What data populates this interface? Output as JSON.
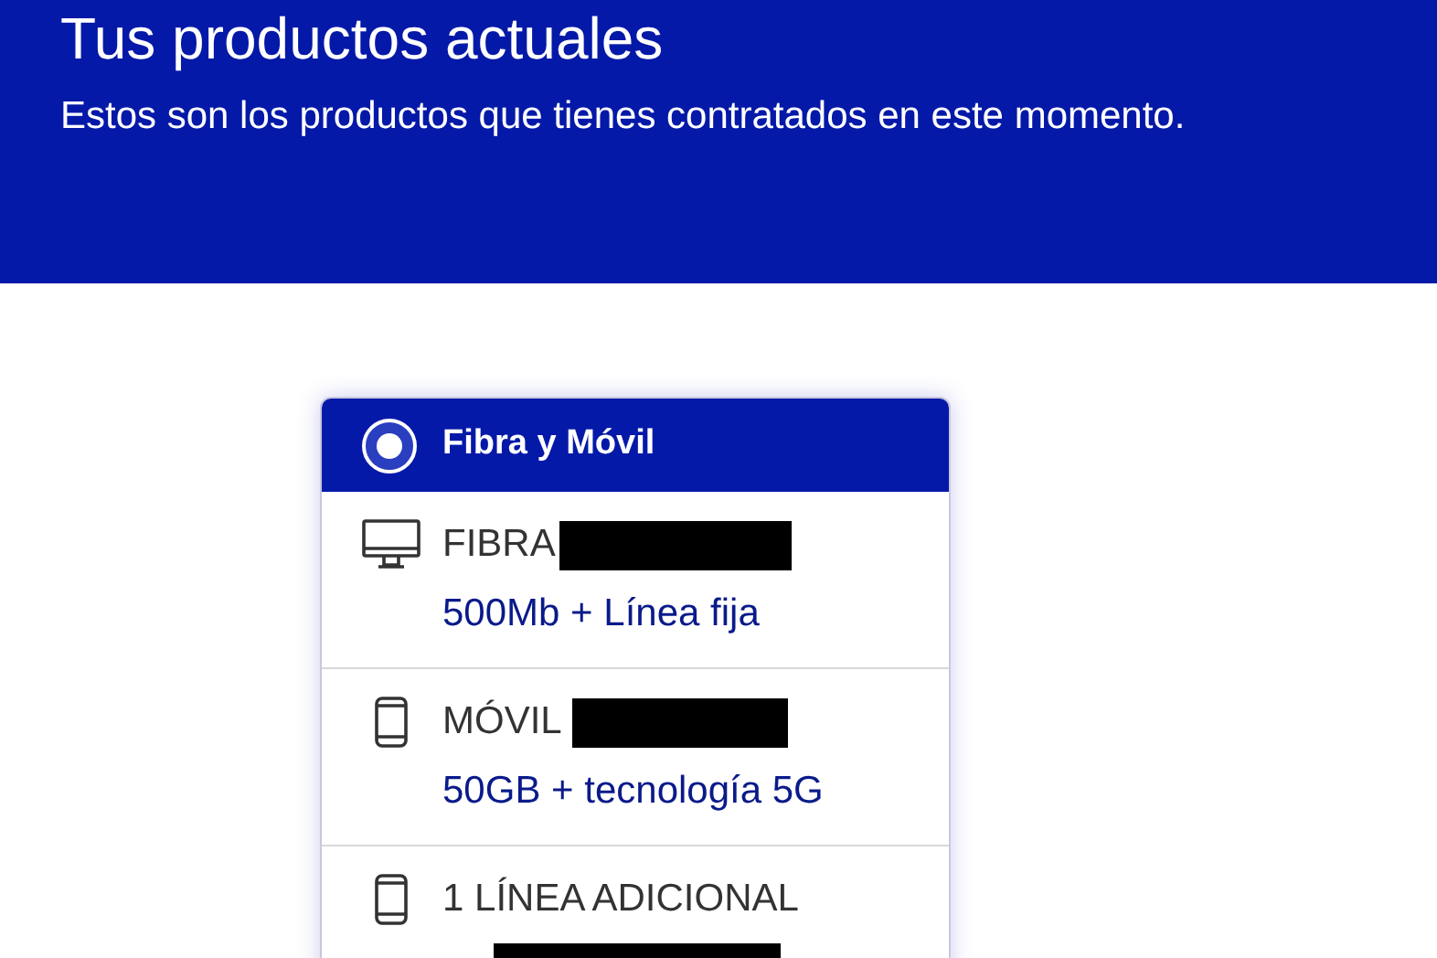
{
  "header": {
    "title": "Tus productos actuales",
    "subtitle": "Estos son los productos que tienes contratados en este momento."
  },
  "plan_card": {
    "name": "Fibra y Móvil",
    "selected": true,
    "products": [
      {
        "kind": "desktop",
        "label": "FIBRA",
        "redacted": true,
        "detail": "500Mb + Línea fija"
      },
      {
        "kind": "phone",
        "label": "MÓVIL",
        "redacted": true,
        "detail": "50GB + tecnología 5G"
      },
      {
        "kind": "phone",
        "label": "1 LÍNEA ADICIONAL",
        "redacted": true
      }
    ]
  }
}
